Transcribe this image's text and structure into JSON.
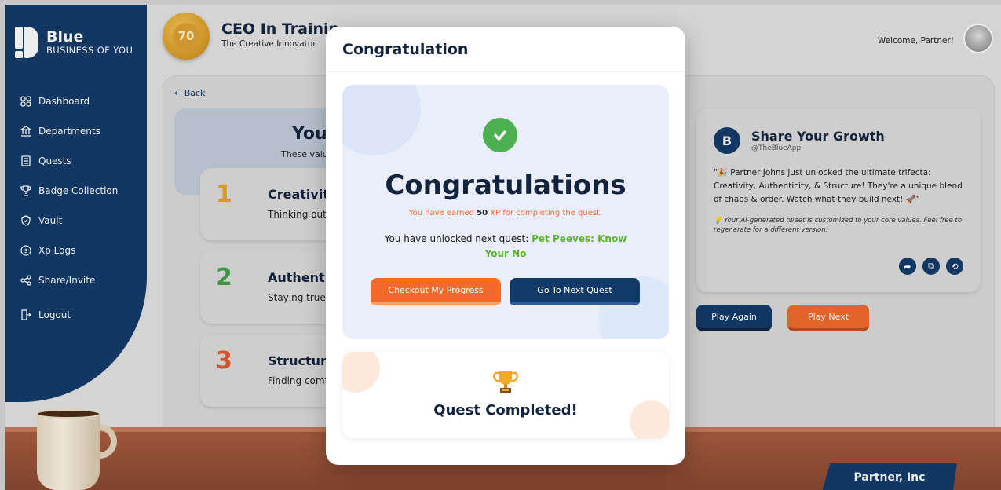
{
  "brand": {
    "name": "Blue",
    "subtitle": "BUSINESS OF YOU"
  },
  "sidebar": {
    "items": [
      {
        "label": "Dashboard",
        "icon": "grid-icon"
      },
      {
        "label": "Departments",
        "icon": "bank-icon"
      },
      {
        "label": "Quests",
        "icon": "scroll-icon"
      },
      {
        "label": "Badge Collection",
        "icon": "trophy-icon"
      },
      {
        "label": "Vault",
        "icon": "shield-icon"
      },
      {
        "label": "Xp Logs",
        "icon": "dollar-icon"
      },
      {
        "label": "Share/Invite",
        "icon": "share-icon"
      },
      {
        "label": "Logout",
        "icon": "logout-icon"
      }
    ]
  },
  "header": {
    "level": "70",
    "title": "CEO In Trainin",
    "subtitle": "The Creative Innovator",
    "welcome": "Welcome, Partner!"
  },
  "main": {
    "back": "← Back",
    "hero_title": "You",
    "hero_text": "These valu",
    "values": [
      {
        "num": "1",
        "name": "Creativity",
        "desc": "Thinking outs",
        "color": "#e8a52a"
      },
      {
        "num": "2",
        "name": "Authentic",
        "desc": "Staying true t",
        "color": "#43a047"
      },
      {
        "num": "3",
        "name": "Structure",
        "desc": "Finding comf",
        "color": "#e65a2e"
      }
    ]
  },
  "share": {
    "logo": "B",
    "title": "Share Your Growth",
    "handle": "@TheBlueApp",
    "text": "\"🎉 Partner Johns just unlocked the ultimate trifecta: Creativity, Authenticity, & Structure! They're a unique blend of chaos & order. Watch what they build next! 🚀\"",
    "note": "💡 Your AI-generated tweet is customized to your core values. Feel free to regenerate for a different version!",
    "play_again": "Play Again",
    "play_next": "Play Next"
  },
  "nameplate": "Partner, Inc",
  "modal": {
    "title": "Congratulation",
    "heading": "Congratulations",
    "xp_prefix": "You have earned ",
    "xp_value": "50",
    "xp_suffix": " XP for completing the quest.",
    "unlock_prefix": "You have unlocked next quest: ",
    "unlock_quest": "Pet Peeves: Know Your No",
    "btn_progress": "Checkout My Progress",
    "btn_next": "Go To Next Quest",
    "complete": "Quest Completed!"
  },
  "colors": {
    "navy": "#123a69",
    "orange": "#f26b2b",
    "green": "#4caf50"
  }
}
